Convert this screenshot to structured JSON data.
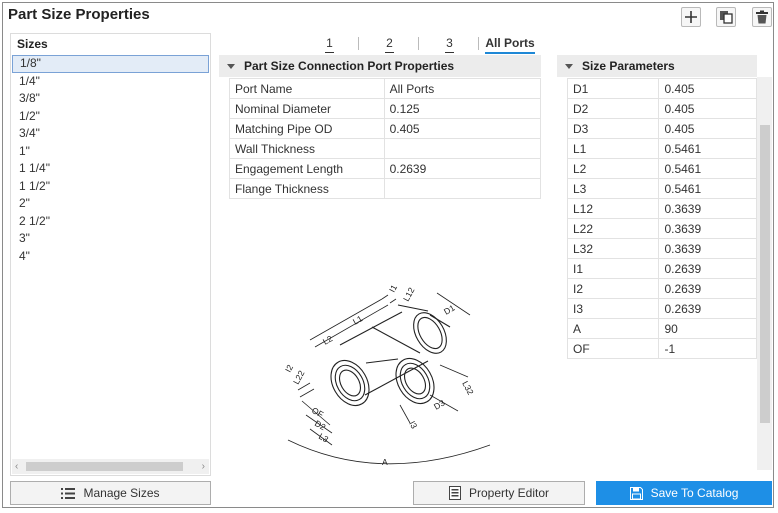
{
  "window": {
    "title": "Part Size Properties"
  },
  "toolbar": {
    "add_icon": "plus-icon",
    "copy_icon": "copy-icon",
    "delete_icon": "trash-icon"
  },
  "sizes": {
    "header": "Sizes",
    "items": [
      "1/8\"",
      "1/4\"",
      "3/8\"",
      "1/2\"",
      "3/4\"",
      "1\"",
      "1 1/4\"",
      "1 1/2\"",
      "2\"",
      "2 1/2\"",
      "3\"",
      "4\""
    ],
    "selected": "1/8\""
  },
  "tabs": [
    "1",
    "2",
    "3",
    "All Ports"
  ],
  "active_tab": "All Ports",
  "port_props": {
    "header": "Part Size Connection Port Properties",
    "rows": [
      {
        "name": "Port Name",
        "value": "All Ports",
        "placeholder": true
      },
      {
        "name": "Nominal Diameter",
        "value": "0.125"
      },
      {
        "name": "Matching Pipe OD",
        "value": "0.405"
      },
      {
        "name": "Wall Thickness",
        "value": ""
      },
      {
        "name": "Engagement Length",
        "value": "0.2639"
      },
      {
        "name": "Flange Thickness",
        "value": ""
      }
    ]
  },
  "size_params": {
    "header": "Size Parameters",
    "rows": [
      {
        "name": "D1",
        "value": "0.405"
      },
      {
        "name": "D2",
        "value": "0.405"
      },
      {
        "name": "D3",
        "value": "0.405"
      },
      {
        "name": "L1",
        "value": "0.5461"
      },
      {
        "name": "L2",
        "value": "0.5461"
      },
      {
        "name": "L3",
        "value": "0.5461"
      },
      {
        "name": "L12",
        "value": "0.3639"
      },
      {
        "name": "L22",
        "value": "0.3639"
      },
      {
        "name": "L32",
        "value": "0.3639"
      },
      {
        "name": "I1",
        "value": "0.2639"
      },
      {
        "name": "I2",
        "value": "0.2639"
      },
      {
        "name": "I3",
        "value": "0.2639"
      },
      {
        "name": "A",
        "value": "90"
      },
      {
        "name": "OF",
        "value": "-1"
      }
    ]
  },
  "diagram": {
    "labels": [
      "I1",
      "L12",
      "L1",
      "D1",
      "L2",
      "I2",
      "L22",
      "OF",
      "D2",
      "L3",
      "L32",
      "D3",
      "I3",
      "A"
    ]
  },
  "buttons": {
    "manage_sizes": "Manage Sizes",
    "property_editor": "Property Editor",
    "save_to_catalog": "Save To Catalog"
  }
}
